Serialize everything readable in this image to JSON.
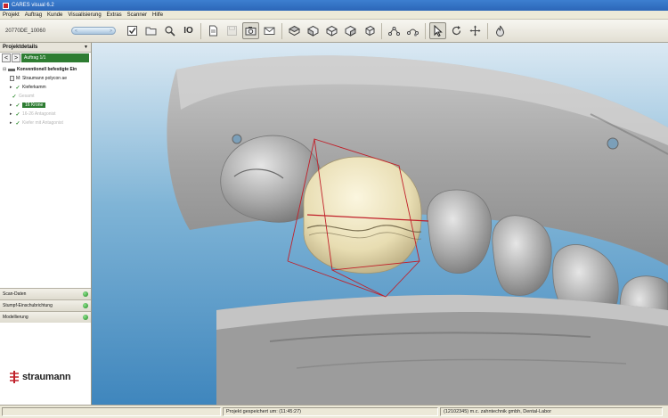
{
  "window": {
    "title": "CARES visual 6.2"
  },
  "menu": [
    "Projekt",
    "Auftrag",
    "Kunde",
    "Visualisierung",
    "Extras",
    "Scanner",
    "Hilfe"
  ],
  "toolbar": {
    "case_id": "20770DE_10060",
    "nav_prev": "<",
    "nav_next": ">",
    "io_label": "IO",
    "buttons": [
      "check-icon",
      "folder-open-icon",
      "magnify-icon",
      "io-icon",
      "document-icon",
      "save-icon",
      "camera-icon",
      "mail-icon",
      "view-top-icon",
      "view-front-icon",
      "view-iso-icon",
      "view-side-icon",
      "view-back-icon",
      "node-graph-icon",
      "node-graph-alt-icon",
      "pointer-icon",
      "rotate-icon",
      "pan-icon",
      "flame-icon"
    ]
  },
  "panel": {
    "header": "Projektdetails",
    "order_label": "Auftrag 1/1",
    "nav_prev": "<",
    "nav_next": ">",
    "tree": [
      {
        "label": "Konventionell befestigte Ein",
        "style": "bold",
        "level": 0,
        "icon": "bar"
      },
      {
        "label": "M: Straumann polycon ae",
        "style": "normal",
        "level": 1,
        "icon": "doc"
      },
      {
        "label": "Kieferkamm",
        "style": "normal",
        "level": 1,
        "icon": "check"
      },
      {
        "label": "Gesamt",
        "style": "grey",
        "level": 2,
        "icon": "check"
      },
      {
        "label": "16 Krone",
        "style": "selected",
        "level": 1,
        "icon": "check"
      },
      {
        "label": "16-26 Antagonist",
        "style": "grey",
        "level": 1,
        "icon": "check"
      },
      {
        "label": "Kiefer mit Antagonist",
        "style": "grey",
        "level": 1,
        "icon": "check"
      }
    ],
    "stages": [
      "Scan-Daten",
      "Stumpf-Einschubrichtung",
      "Modellierung"
    ],
    "logo_text": "straumann",
    "status_color": "#2e9a2e"
  },
  "status": {
    "saved": "Projekt gespeichert um: (11:45:27)",
    "user": "(12102345) m.c. zahntechnik gmbh, Dental-Labor"
  },
  "colors": {
    "accent": "#2e7d32",
    "crown": "#efe6bf",
    "model": "#a9a9a9",
    "bounding_box": "#c0202a"
  }
}
